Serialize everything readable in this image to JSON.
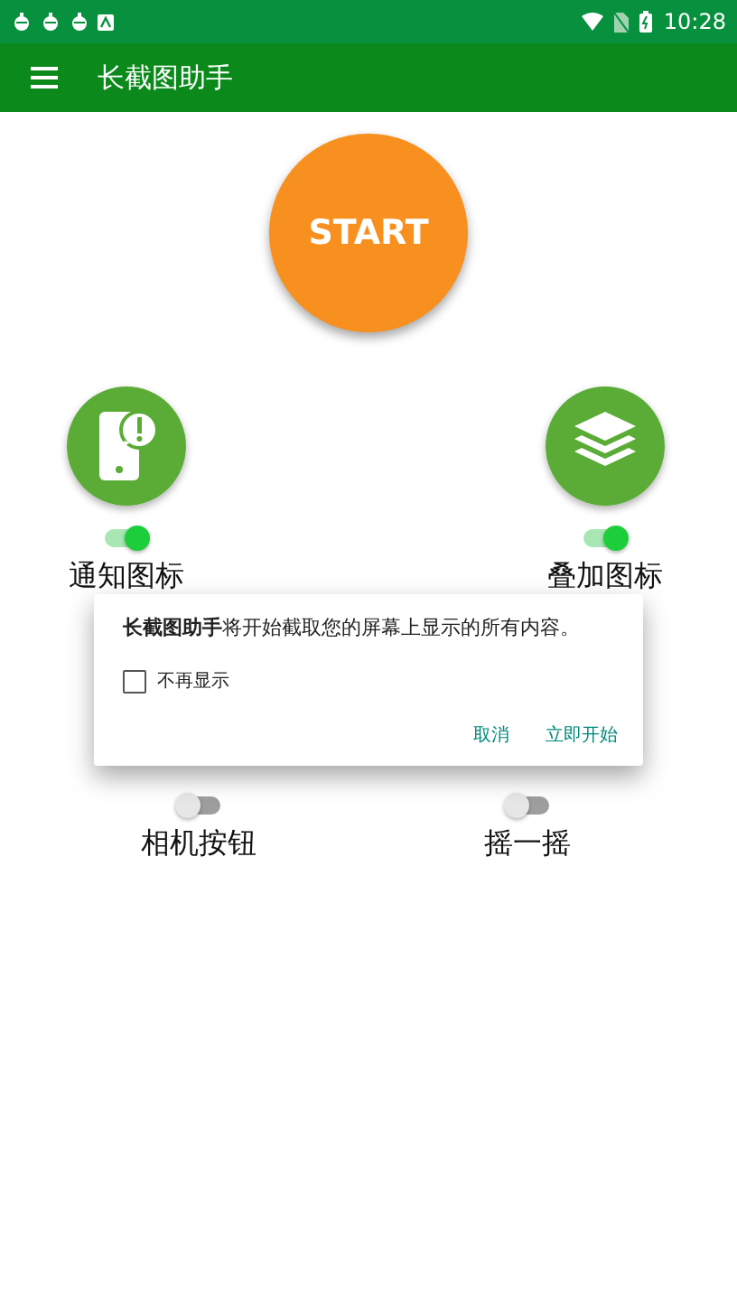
{
  "status_bar": {
    "time": "10:28"
  },
  "app_bar": {
    "title": "长截图助手"
  },
  "start_button": {
    "label": "START"
  },
  "feature_rows": [
    {
      "items": [
        {
          "kind": "notify",
          "label": "通知图标",
          "on": true
        },
        {
          "kind": "layers",
          "label": "叠加图标",
          "on": true
        }
      ]
    },
    {
      "items": [
        {
          "kind": "plain",
          "label": "相机按钮",
          "on": false
        },
        {
          "kind": "plain",
          "label": "摇一摇",
          "on": false
        }
      ]
    }
  ],
  "dialog": {
    "message": "**长截图助手**将开始截取您的屏幕上显示的所有内容。",
    "checkbox": {
      "label": "不再显示",
      "checked": false
    },
    "buttons": [
      "取消",
      "立即开始"
    ]
  }
}
